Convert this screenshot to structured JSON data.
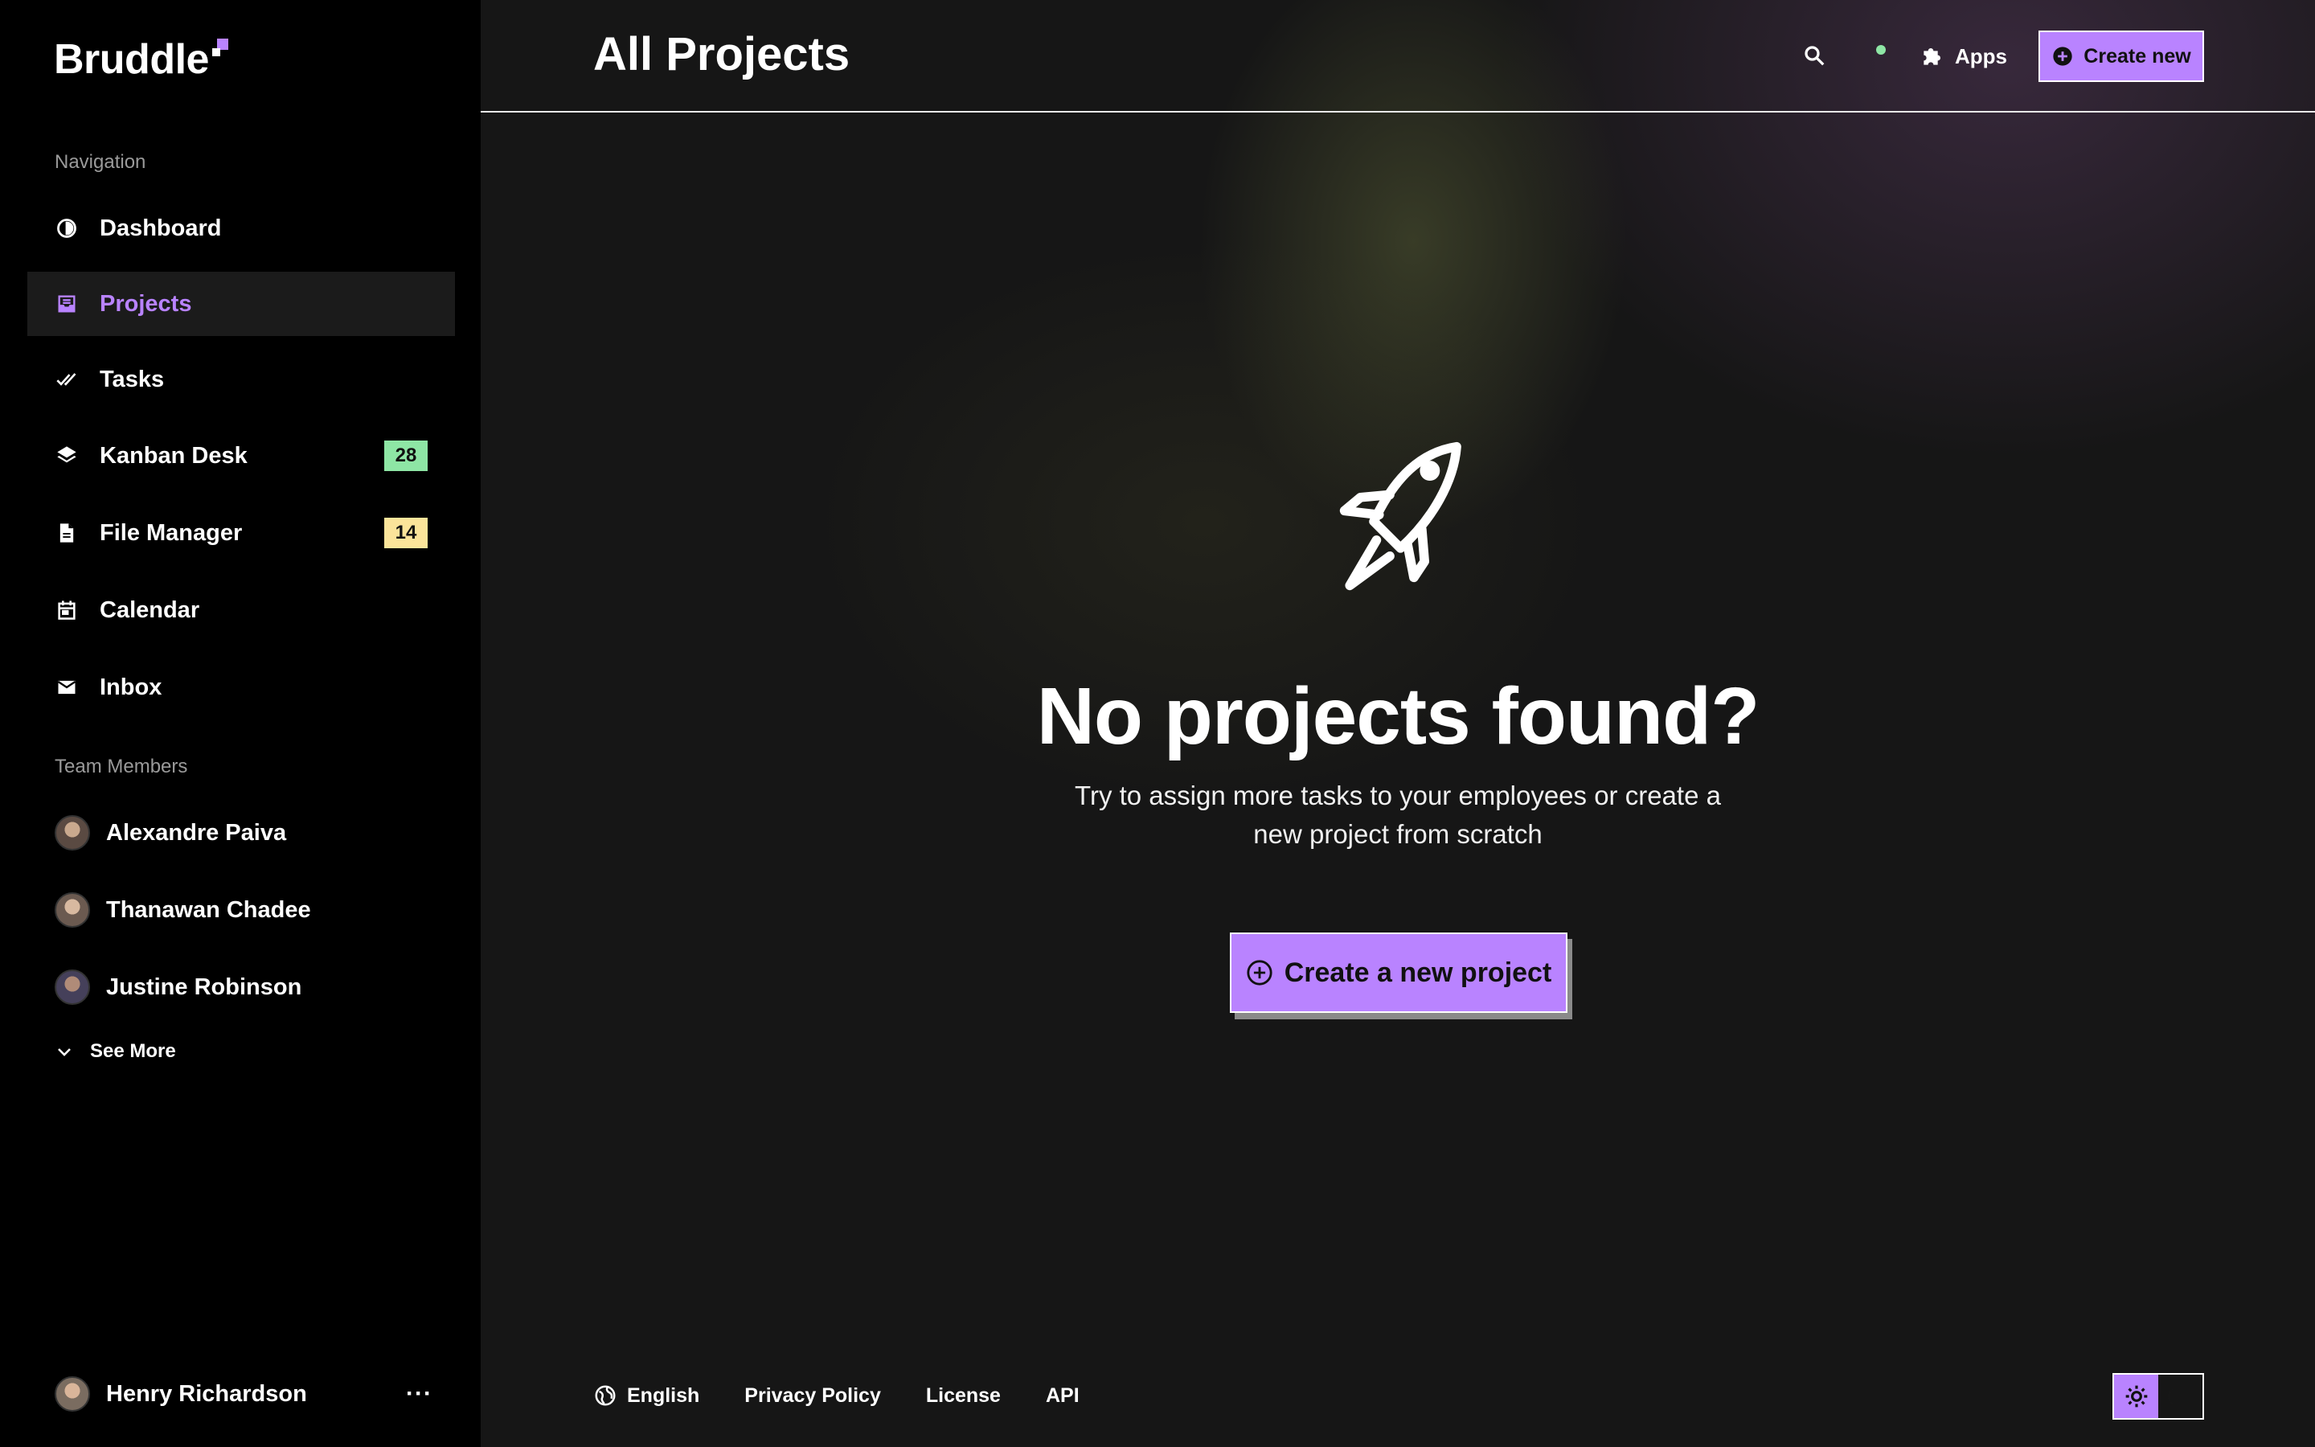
{
  "app": {
    "logo_text": "Bruddle",
    "page_title": "All Projects"
  },
  "sidebar": {
    "navigation_label": "Navigation",
    "items": [
      {
        "label": "Dashboard",
        "icon": "dashboard-icon"
      },
      {
        "label": "Projects",
        "icon": "inbox-tray-icon",
        "active": true
      },
      {
        "label": "Tasks",
        "icon": "double-check-icon"
      },
      {
        "label": "Kanban Desk",
        "icon": "layers-icon",
        "badge": "28",
        "badge_color": "#8ee6a5"
      },
      {
        "label": "File Manager",
        "icon": "file-icon",
        "badge": "14",
        "badge_color": "#fbe49a"
      },
      {
        "label": "Calendar",
        "icon": "calendar-icon"
      },
      {
        "label": "Inbox",
        "icon": "mail-icon"
      }
    ],
    "team_label": "Team Members",
    "members": [
      {
        "name": "Alexandre Paiva"
      },
      {
        "name": "Thanawan Chadee"
      },
      {
        "name": "Justine Robinson"
      }
    ],
    "see_more": "See More",
    "current_user": {
      "name": "Henry Richardson",
      "more": "···"
    }
  },
  "header": {
    "apps_label": "Apps",
    "create_label": "Create new"
  },
  "empty_state": {
    "title": "No projects found?",
    "description": "Try to assign more tasks to your employees or create a new project from scratch",
    "cta_label": "Create a new project"
  },
  "footer": {
    "language": "English",
    "links": [
      "Privacy Policy",
      "License",
      "API"
    ]
  },
  "colors": {
    "accent": "#b983ff",
    "sidebar_bg": "#000000",
    "main_bg": "#161616",
    "badge_green": "#8ee6a5",
    "badge_yellow": "#fbe49a",
    "status_online": "#8ee6a5"
  }
}
